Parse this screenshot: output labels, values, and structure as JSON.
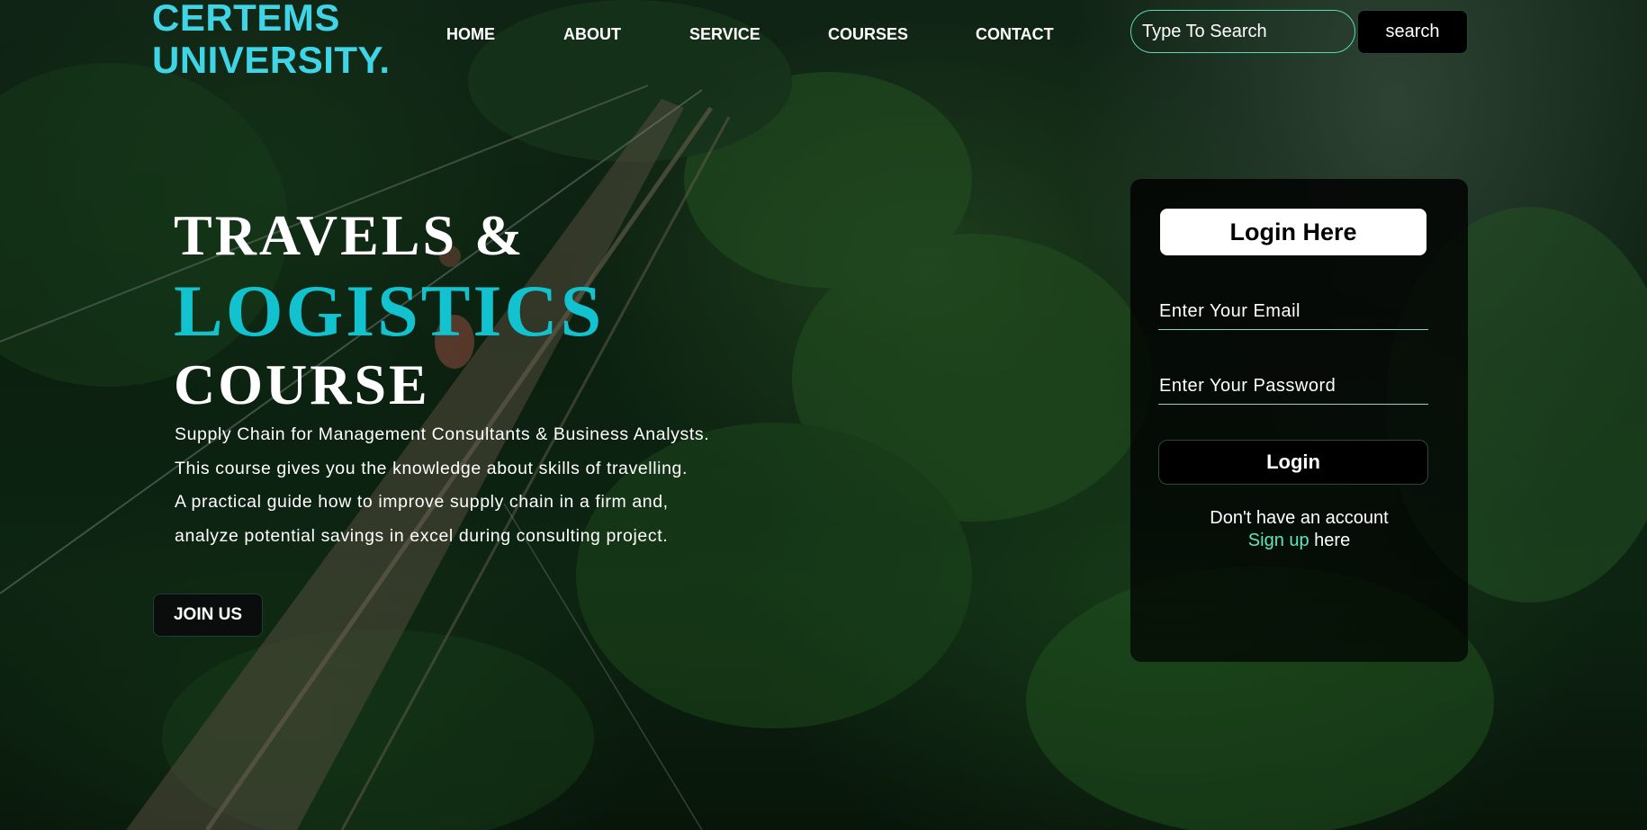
{
  "brand": {
    "line1": "CERTEMS",
    "line2": "UNIVERSITY."
  },
  "nav": {
    "items": [
      "HOME",
      "ABOUT",
      "SERVICE",
      "COURSES",
      "CONTACT"
    ]
  },
  "search": {
    "placeholder": "Type To Search",
    "button_label": "search"
  },
  "hero": {
    "line1": "TRAVELS &",
    "line2": "LOGISTICS",
    "line3": "COURSE",
    "description": [
      "Supply Chain for Management Consultants & Business Analysts.",
      "This course gives you the knowledge about skills of travelling.",
      "A practical guide how to improve supply chain in a firm and,",
      "analyze potential savings in excel during consulting project."
    ],
    "join_label": "JOIN US"
  },
  "login": {
    "title": "Login Here",
    "email_placeholder": "Enter Your Email",
    "password_placeholder": "Enter Your Password",
    "button_label": "Login",
    "no_account_text": "Don't have an account",
    "signup_link": "Sign up",
    "signup_suffix": " here"
  },
  "colors": {
    "brand_accent": "#3fd4e6",
    "hero_accent": "#12c3cf",
    "link_accent": "#5ee6c0",
    "input_border": "#5ed6b8"
  }
}
